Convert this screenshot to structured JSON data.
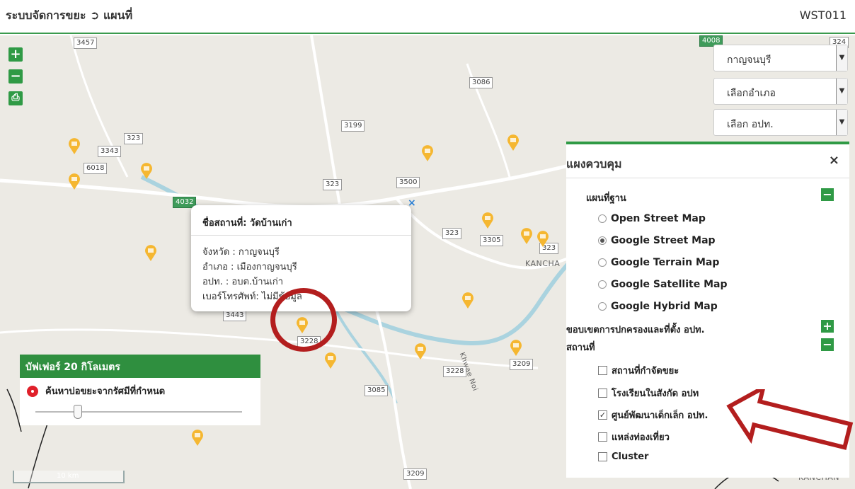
{
  "header": {
    "title": "ระบบจัดการขยะ ➲ แผนที่",
    "code": "WST011"
  },
  "map": {
    "zoom_in": "+",
    "zoom_out": "−",
    "print": "⎙",
    "road_labels": [
      "3457",
      "3086",
      "3199",
      "323",
      "3343",
      "6018",
      "3500",
      "323",
      "4032",
      "323",
      "3305",
      "323",
      "3443",
      "3228",
      "3228",
      "3209",
      "3085",
      "3209",
      "4008",
      "324"
    ],
    "town_labels": [
      "KANCHA",
      "KANCHAN"
    ],
    "river_label": "Khwae Noi",
    "scale": "10 km",
    "colors": {
      "accent": "#2f9a45",
      "pin": "#f5b731",
      "highlight": "#b31e1e"
    }
  },
  "filters": {
    "province": "กาญจนบุรี",
    "district": "เลือกอำเภอ",
    "org": "เลือก อปท."
  },
  "popup": {
    "title": "ชื่อสถานที่: วัดบ้านเก่า",
    "province": "จังหวัด : กาญจนบุรี",
    "district": "อำเภอ : เมืองกาญจนบุรี",
    "org": "อปท. : อบต.บ้านเก่า",
    "phone": "เบอร์โทรศัพท์: ไม่มีข้อมูล",
    "close": "×"
  },
  "buffer": {
    "title": "บัฟเฟอร์ 20 กิโลเมตร",
    "search_label": "ค้นหาบ่อขยะจากรัศมีที่กำหนด",
    "slider_fraction": 0.2
  },
  "panel": {
    "title": "แผงควบคุม",
    "close": "×",
    "base_map_title": "แผนที่ฐาน",
    "base_maps": [
      {
        "label": "Open Street Map",
        "selected": false
      },
      {
        "label": "Google Street Map",
        "selected": true
      },
      {
        "label": "Google Terrain Map",
        "selected": false
      },
      {
        "label": "Google Satellite Map",
        "selected": false
      },
      {
        "label": "Google Hybrid Map",
        "selected": false
      }
    ],
    "boundary_title": "ขอบเขตการปกครองและที่ตั้ง อปท.",
    "places_title": "สถานที่",
    "places": [
      {
        "label": "สถานที่กำจัดขยะ",
        "checked": false
      },
      {
        "label": "โรงเรียนในสังกัด อปท",
        "checked": false
      },
      {
        "label": "ศูนย์พัฒนาเด็กเล็ก อปท.",
        "checked": true
      },
      {
        "label": "แหล่งท่องเที่ยว",
        "checked": false
      },
      {
        "label": "Cluster",
        "checked": false
      }
    ],
    "toggle_minus": "−",
    "toggle_plus": "+"
  }
}
